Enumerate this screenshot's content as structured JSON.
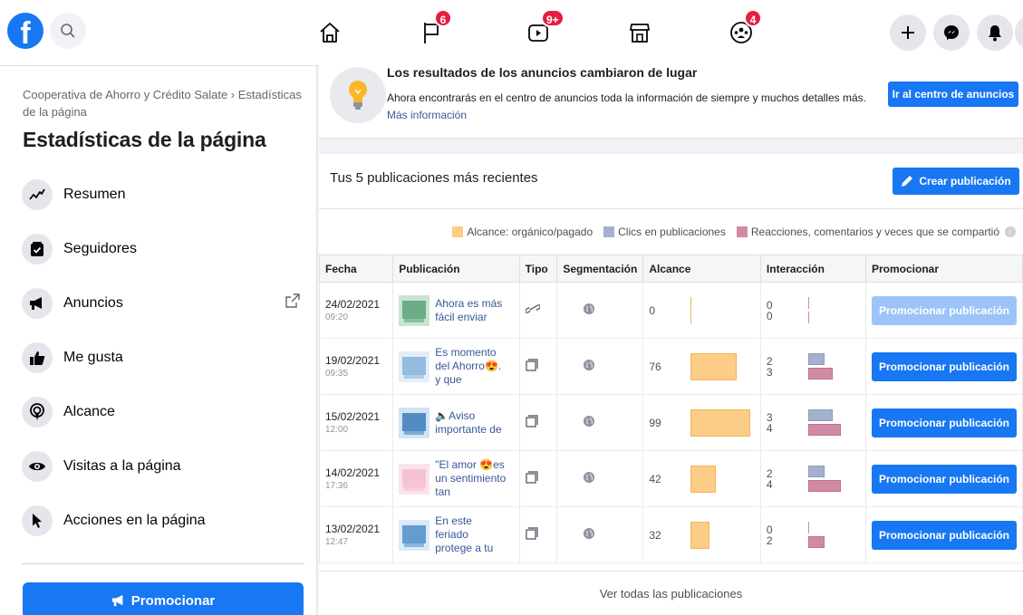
{
  "topbar": {
    "logo_letter": "f",
    "nav": [
      {
        "name": "home",
        "badge": ""
      },
      {
        "name": "pages",
        "badge": "6"
      },
      {
        "name": "watch",
        "badge": "9+"
      },
      {
        "name": "marketplace",
        "badge": ""
      },
      {
        "name": "groups",
        "badge": "4"
      }
    ],
    "actions": [
      "plus-icon",
      "messenger-icon",
      "bell-icon"
    ]
  },
  "sidebar": {
    "breadcrumb": "Cooperativa de Ahorro y Crédito Salate › Estadísticas de la página",
    "title": "Estadísticas de la página",
    "items": [
      {
        "label": "Resumen",
        "icon": "trend-icon"
      },
      {
        "label": "Seguidores",
        "icon": "followers-icon"
      },
      {
        "label": "Anuncios",
        "icon": "megaphone-icon"
      },
      {
        "label": "Me gusta",
        "icon": "thumbs-up-icon"
      },
      {
        "label": "Alcance",
        "icon": "reach-icon"
      },
      {
        "label": "Visitas a la página",
        "icon": "eye-icon"
      },
      {
        "label": "Acciones en la página",
        "icon": "cursor-icon"
      }
    ],
    "promote_label": "Promocionar"
  },
  "banner": {
    "title": "Los resultados de los anuncios cambiaron de lugar",
    "text": "Ahora encontrarás en el centro de anuncios toda la información de siempre y muchos detalles más.",
    "link": "Más información",
    "button": "Ir al centro de anuncios"
  },
  "posts": {
    "title": "Tus 5 publicaciones más recientes",
    "create_button": "Crear publicación",
    "legend": {
      "reach": "Alcance: orgánico/pagado",
      "clicks": "Clics en publicaciones",
      "reactions": "Reacciones, comentarios y veces que se compartió"
    },
    "columns": [
      "Fecha",
      "Publicación",
      "Tipo",
      "Segmentación",
      "Alcance",
      "Interacción",
      "Promocionar"
    ],
    "rows": [
      {
        "date": "24/02/2021",
        "time": "09:20",
        "text": "Ahora es más fácil enviar",
        "type": "link",
        "reach": "0",
        "reach_value": 0,
        "clicks": "0",
        "clicks_value": 0,
        "reactions": "0",
        "reactions_value": 0,
        "promote": "Promocionar publicación",
        "promote_enabled": false
      },
      {
        "date": "19/02/2021",
        "time": "09:35",
        "text": "Es momento del Ahorro😍. y que",
        "type": "photo",
        "reach": "76",
        "reach_value": 76,
        "clicks": "2",
        "clicks_value": 2,
        "reactions": "3",
        "reactions_value": 3,
        "promote": "Promocionar publicación",
        "promote_enabled": true
      },
      {
        "date": "15/02/2021",
        "time": "12:00",
        "text": "🔈Aviso importante de",
        "type": "photo",
        "reach": "99",
        "reach_value": 99,
        "clicks": "3",
        "clicks_value": 3,
        "reactions": "4",
        "reactions_value": 4,
        "promote": "Promocionar publicación",
        "promote_enabled": true
      },
      {
        "date": "14/02/2021",
        "time": "17:36",
        "text": "\"El amor 😍es un sentimiento tan",
        "type": "photo",
        "reach": "42",
        "reach_value": 42,
        "clicks": "2",
        "clicks_value": 2,
        "reactions": "4",
        "reactions_value": 4,
        "promote": "Promocionar publicación",
        "promote_enabled": true
      },
      {
        "date": "13/02/2021",
        "time": "12:47",
        "text": "En este feriado protege a tu",
        "type": "photo",
        "reach": "32",
        "reach_value": 32,
        "clicks": "0",
        "clicks_value": 0,
        "reactions": "2",
        "reactions_value": 2,
        "promote": "Promocionar publicación",
        "promote_enabled": true
      }
    ],
    "see_all": "Ver todas las publicaciones"
  },
  "colors": {
    "brand": "#1877f2",
    "reach": "#fbcd86",
    "clicks": "#a3b1cc",
    "reactions": "#d18aa3",
    "badge": "#e41e3f"
  }
}
